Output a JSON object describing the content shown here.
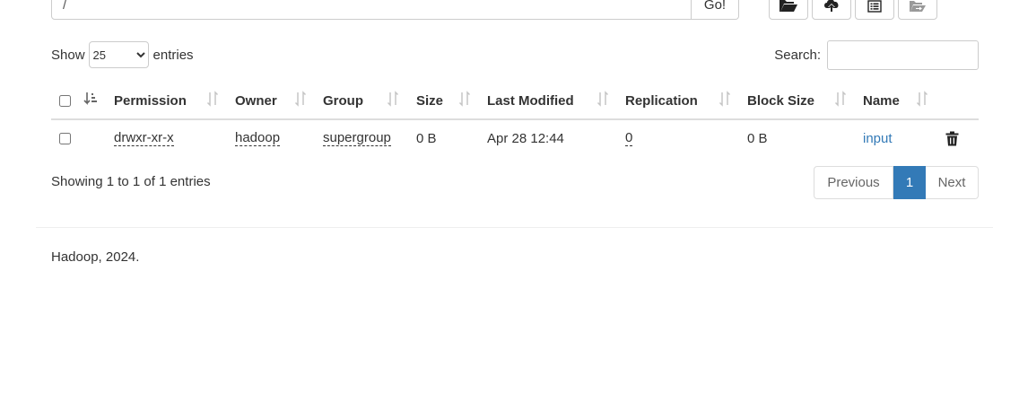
{
  "path_bar": {
    "path_value": "/",
    "go_label": "Go!"
  },
  "toolbar": {
    "buttons": [
      {
        "icon": "folder-open-icon"
      },
      {
        "icon": "upload-icon"
      },
      {
        "icon": "list-icon"
      },
      {
        "icon": "folder-move-icon"
      }
    ]
  },
  "length": {
    "show_label": "Show",
    "selected": "25",
    "entries_label": "entries"
  },
  "search": {
    "label": "Search:",
    "value": ""
  },
  "table": {
    "columns": [
      "Permission",
      "Owner",
      "Group",
      "Size",
      "Last Modified",
      "Replication",
      "Block Size",
      "Name"
    ],
    "rows": [
      {
        "permission": "drwxr-xr-x",
        "owner": "hadoop",
        "group": "supergroup",
        "size": "0 B",
        "last_modified": "Apr 28 12:44",
        "replication": "0",
        "block_size": "0 B",
        "name": "input"
      }
    ]
  },
  "info": {
    "text": "Showing 1 to 1 of 1 entries"
  },
  "pagination": {
    "previous_label": "Previous",
    "current_page": "1",
    "next_label": "Next"
  },
  "footer": {
    "text": "Hadoop, 2024."
  },
  "colors": {
    "link": "#337ab7",
    "active_page": "#337ab7"
  }
}
